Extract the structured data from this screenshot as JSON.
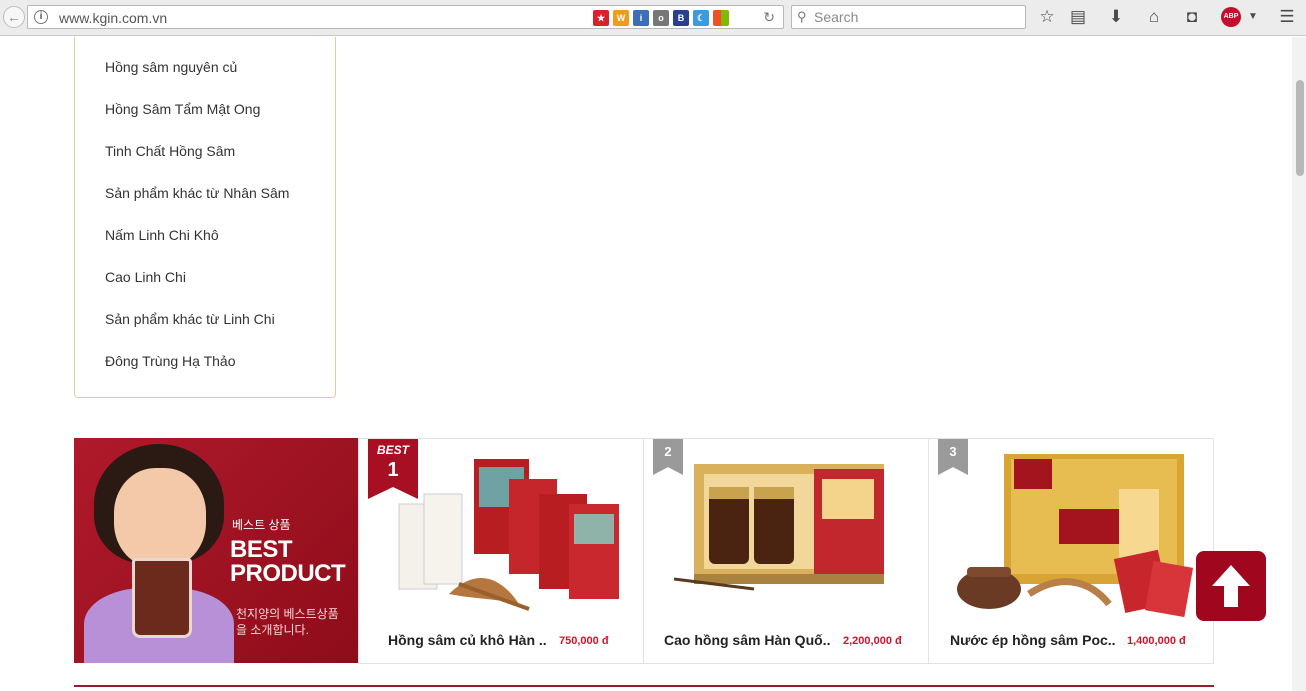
{
  "browser": {
    "url": "www.kgin.com.vn",
    "search_placeholder": "Search",
    "abp_label": "ABP"
  },
  "category_menu": {
    "items": [
      "Hồng sâm nguyên củ",
      "Hồng Sâm Tẩm Mật Ong",
      "Tinh Chất Hồng Sâm",
      "Sản phẩm khác từ Nhân Sâm",
      "Nấm Linh Chi Khô",
      "Cao Linh Chi",
      "Sản phẩm khác từ Linh Chi",
      "Đông Trùng Hạ Thảo"
    ]
  },
  "best_banner": {
    "korean_small": "베스트 상품",
    "title_line1": "BEST",
    "title_line2": "PRODUCT",
    "korean_desc": "천지양의 베스트상품을 소개합니다."
  },
  "products": [
    {
      "rank_label": "BEST",
      "rank": "1",
      "name": "Hồng sâm củ khô Hàn ..",
      "price": "750,000 đ"
    },
    {
      "rank": "2",
      "name": "Cao hồng sâm Hàn Quố..",
      "price": "2,200,000 đ"
    },
    {
      "rank": "3",
      "name": "Nước ép hồng sâm Poc..",
      "price": "1,400,000 đ"
    }
  ],
  "colors": {
    "accent": "#a0071f",
    "price": "#d0142c",
    "menu_border": "#e5c9a3"
  }
}
